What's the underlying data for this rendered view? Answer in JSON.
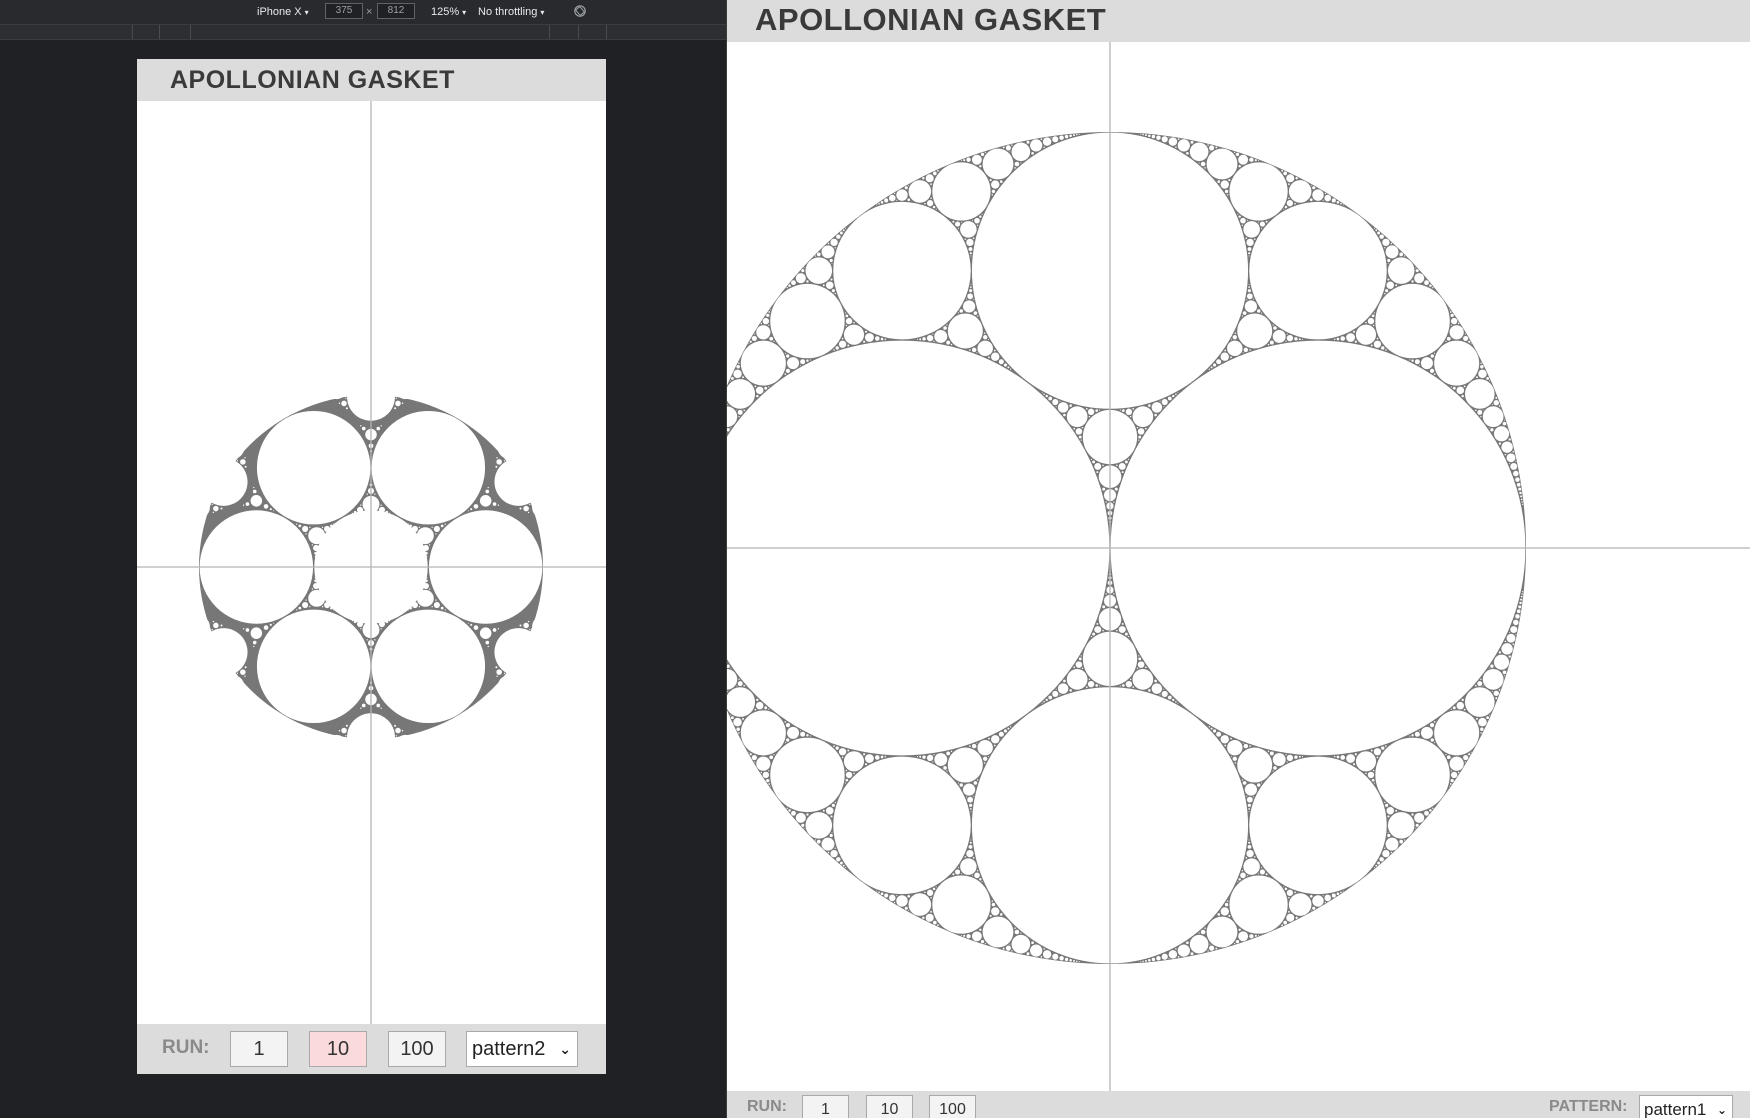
{
  "devtools": {
    "device": "iPhone X",
    "width": "375",
    "times": "×",
    "height": "812",
    "zoom": "125%",
    "throttling": "No throttling",
    "caret": "▾"
  },
  "mobile_page": {
    "title": "APOLLONIAN GASKET",
    "run_label": "RUN:",
    "run_buttons": [
      "1",
      "10",
      "100"
    ],
    "active_run": "10",
    "pattern_value": "pattern2",
    "chevron": "⌄"
  },
  "desktop_page": {
    "title": "APOLLONIAN GASKET",
    "run_label": "RUN:",
    "run_buttons": [
      "1",
      "10",
      "100"
    ],
    "pattern_label": "PATTERN:",
    "pattern_value": "pattern1",
    "chevron": "⌄"
  },
  "colors": {
    "stroke": "#777777",
    "axis": "#b4b4b4",
    "highlight": "#fbdadc"
  },
  "gasket_configs": {
    "mobile": {
      "pattern": "pattern2",
      "inner_circles": 6
    },
    "desktop": {
      "pattern": "pattern1",
      "inner_circles": 4
    }
  }
}
